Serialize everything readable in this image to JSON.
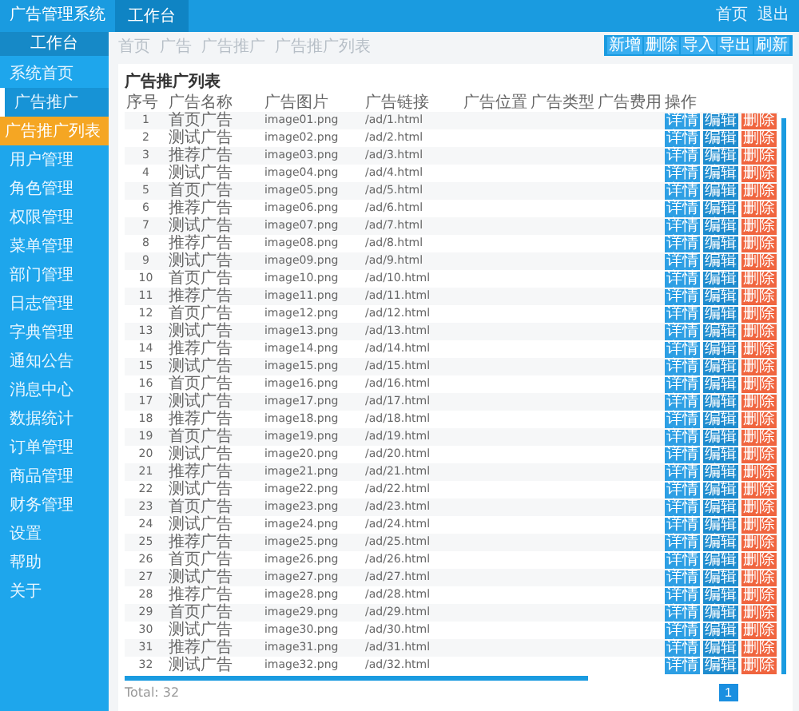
{
  "header": {
    "title": "广告管理系统",
    "tabs": [
      {
        "label": "工作台",
        "selected": true
      }
    ],
    "links": [
      "首页",
      "退出"
    ]
  },
  "sidebar": {
    "title": "工作台",
    "items": [
      {
        "label": "系统首页",
        "selected": false
      },
      {
        "label": "广告推广",
        "selected": false,
        "expanded": true,
        "children": [
          {
            "label": "广告推广列表",
            "selected": true
          }
        ]
      },
      {
        "label": "用户管理",
        "selected": false
      },
      {
        "label": "角色管理",
        "selected": false
      },
      {
        "label": "权限管理",
        "selected": false
      },
      {
        "label": "菜单管理",
        "selected": false
      },
      {
        "label": "部门管理",
        "selected": false
      },
      {
        "label": "日志管理",
        "selected": false
      },
      {
        "label": "字典管理",
        "selected": false
      },
      {
        "label": "通知公告",
        "selected": false
      },
      {
        "label": "消息中心",
        "selected": false
      },
      {
        "label": "数据统计",
        "selected": false
      },
      {
        "label": "订单管理",
        "selected": false
      },
      {
        "label": "商品管理",
        "selected": false
      },
      {
        "label": "财务管理",
        "selected": false
      },
      {
        "label": "设置",
        "selected": false
      },
      {
        "label": "帮助",
        "selected": false
      },
      {
        "label": "关于",
        "selected": false
      }
    ]
  },
  "breadcrumb": [
    "首页",
    "广告",
    "广告推广",
    "广告推广列表"
  ],
  "toolbar": [
    "新增",
    "删除",
    "导入",
    "导出",
    "刷新"
  ],
  "panel": {
    "title": "广告推广列表",
    "columns": [
      "序号",
      "广告名称",
      "广告图片",
      "广告链接",
      "广告位置",
      "广告类型",
      "广告费用",
      "操作"
    ],
    "rows": [
      {
        "no": "1",
        "name": "首页广告",
        "image": "image01.png",
        "link": "/ad/1.html",
        "actions": [
          {
            "label": "详情",
            "kind": "view"
          },
          {
            "label": "编辑",
            "kind": "edit"
          },
          {
            "label": "删除",
            "kind": "delete"
          }
        ]
      },
      {
        "no": "2",
        "name": "测试广告",
        "image": "image02.png",
        "link": "/ad/2.html",
        "actions": [
          {
            "label": "详情",
            "kind": "view"
          },
          {
            "label": "编辑",
            "kind": "edit"
          },
          {
            "label": "删除",
            "kind": "delete"
          }
        ]
      },
      {
        "no": "3",
        "name": "推荐广告",
        "image": "image03.png",
        "link": "/ad/3.html",
        "actions": [
          {
            "label": "详情",
            "kind": "view"
          },
          {
            "label": "编辑",
            "kind": "edit"
          },
          {
            "label": "删除",
            "kind": "delete"
          }
        ]
      },
      {
        "no": "4",
        "name": "测试广告",
        "image": "image04.png",
        "link": "/ad/4.html",
        "actions": [
          {
            "label": "详情",
            "kind": "view"
          },
          {
            "label": "编辑",
            "kind": "edit"
          },
          {
            "label": "删除",
            "kind": "delete"
          }
        ]
      },
      {
        "no": "5",
        "name": "首页广告",
        "image": "image05.png",
        "link": "/ad/5.html",
        "actions": [
          {
            "label": "详情",
            "kind": "view"
          },
          {
            "label": "编辑",
            "kind": "edit"
          },
          {
            "label": "删除",
            "kind": "delete"
          }
        ]
      },
      {
        "no": "6",
        "name": "推荐广告",
        "image": "image06.png",
        "link": "/ad/6.html",
        "actions": [
          {
            "label": "详情",
            "kind": "view"
          },
          {
            "label": "编辑",
            "kind": "edit"
          },
          {
            "label": "删除",
            "kind": "delete"
          }
        ]
      },
      {
        "no": "7",
        "name": "测试广告",
        "image": "image07.png",
        "link": "/ad/7.html",
        "actions": [
          {
            "label": "详情",
            "kind": "view"
          },
          {
            "label": "编辑",
            "kind": "edit"
          },
          {
            "label": "删除",
            "kind": "delete"
          }
        ]
      },
      {
        "no": "8",
        "name": "推荐广告",
        "image": "image08.png",
        "link": "/ad/8.html",
        "actions": [
          {
            "label": "详情",
            "kind": "view"
          },
          {
            "label": "编辑",
            "kind": "edit"
          },
          {
            "label": "删除",
            "kind": "delete"
          }
        ]
      },
      {
        "no": "9",
        "name": "测试广告",
        "image": "image09.png",
        "link": "/ad/9.html",
        "actions": [
          {
            "label": "详情",
            "kind": "view"
          },
          {
            "label": "编辑",
            "kind": "edit"
          },
          {
            "label": "删除",
            "kind": "delete"
          }
        ]
      },
      {
        "no": "10",
        "name": "首页广告",
        "image": "image10.png",
        "link": "/ad/10.html",
        "actions": [
          {
            "label": "详情",
            "kind": "view"
          },
          {
            "label": "编辑",
            "kind": "edit"
          },
          {
            "label": "删除",
            "kind": "delete"
          }
        ]
      },
      {
        "no": "11",
        "name": "推荐广告",
        "image": "image11.png",
        "link": "/ad/11.html",
        "actions": [
          {
            "label": "详情",
            "kind": "view"
          },
          {
            "label": "编辑",
            "kind": "edit"
          },
          {
            "label": "删除",
            "kind": "delete"
          }
        ]
      },
      {
        "no": "12",
        "name": "首页广告",
        "image": "image12.png",
        "link": "/ad/12.html",
        "actions": [
          {
            "label": "详情",
            "kind": "view"
          },
          {
            "label": "编辑",
            "kind": "edit"
          },
          {
            "label": "删除",
            "kind": "delete"
          }
        ]
      },
      {
        "no": "13",
        "name": "测试广告",
        "image": "image13.png",
        "link": "/ad/13.html",
        "actions": [
          {
            "label": "详情",
            "kind": "view"
          },
          {
            "label": "编辑",
            "kind": "edit"
          },
          {
            "label": "删除",
            "kind": "delete"
          }
        ]
      },
      {
        "no": "14",
        "name": "推荐广告",
        "image": "image14.png",
        "link": "/ad/14.html",
        "actions": [
          {
            "label": "详情",
            "kind": "view"
          },
          {
            "label": "编辑",
            "kind": "edit"
          },
          {
            "label": "删除",
            "kind": "delete"
          }
        ]
      },
      {
        "no": "15",
        "name": "测试广告",
        "image": "image15.png",
        "link": "/ad/15.html",
        "actions": [
          {
            "label": "详情",
            "kind": "view"
          },
          {
            "label": "编辑",
            "kind": "edit"
          },
          {
            "label": "删除",
            "kind": "delete"
          }
        ]
      },
      {
        "no": "16",
        "name": "首页广告",
        "image": "image16.png",
        "link": "/ad/16.html",
        "actions": [
          {
            "label": "详情",
            "kind": "view"
          },
          {
            "label": "编辑",
            "kind": "edit"
          },
          {
            "label": "删除",
            "kind": "delete"
          }
        ]
      },
      {
        "no": "17",
        "name": "测试广告",
        "image": "image17.png",
        "link": "/ad/17.html",
        "actions": [
          {
            "label": "详情",
            "kind": "view"
          },
          {
            "label": "编辑",
            "kind": "edit"
          },
          {
            "label": "删除",
            "kind": "delete"
          }
        ]
      },
      {
        "no": "18",
        "name": "推荐广告",
        "image": "image18.png",
        "link": "/ad/18.html",
        "actions": [
          {
            "label": "详情",
            "kind": "view"
          },
          {
            "label": "编辑",
            "kind": "edit"
          },
          {
            "label": "删除",
            "kind": "delete"
          }
        ]
      },
      {
        "no": "19",
        "name": "首页广告",
        "image": "image19.png",
        "link": "/ad/19.html",
        "actions": [
          {
            "label": "详情",
            "kind": "view"
          },
          {
            "label": "编辑",
            "kind": "edit"
          },
          {
            "label": "删除",
            "kind": "delete"
          }
        ]
      },
      {
        "no": "20",
        "name": "测试广告",
        "image": "image20.png",
        "link": "/ad/20.html",
        "actions": [
          {
            "label": "详情",
            "kind": "view"
          },
          {
            "label": "编辑",
            "kind": "edit"
          },
          {
            "label": "删除",
            "kind": "delete"
          }
        ]
      },
      {
        "no": "21",
        "name": "推荐广告",
        "image": "image21.png",
        "link": "/ad/21.html",
        "actions": [
          {
            "label": "详情",
            "kind": "view"
          },
          {
            "label": "编辑",
            "kind": "edit"
          },
          {
            "label": "删除",
            "kind": "delete"
          }
        ]
      },
      {
        "no": "22",
        "name": "测试广告",
        "image": "image22.png",
        "link": "/ad/22.html",
        "actions": [
          {
            "label": "详情",
            "kind": "view"
          },
          {
            "label": "编辑",
            "kind": "edit"
          },
          {
            "label": "删除",
            "kind": "delete"
          }
        ]
      },
      {
        "no": "23",
        "name": "首页广告",
        "image": "image23.png",
        "link": "/ad/23.html",
        "actions": [
          {
            "label": "详情",
            "kind": "view"
          },
          {
            "label": "编辑",
            "kind": "edit"
          },
          {
            "label": "删除",
            "kind": "delete"
          }
        ]
      },
      {
        "no": "24",
        "name": "测试广告",
        "image": "image24.png",
        "link": "/ad/24.html",
        "actions": [
          {
            "label": "详情",
            "kind": "view"
          },
          {
            "label": "编辑",
            "kind": "edit"
          },
          {
            "label": "删除",
            "kind": "delete"
          }
        ]
      },
      {
        "no": "25",
        "name": "推荐广告",
        "image": "image25.png",
        "link": "/ad/25.html",
        "actions": [
          {
            "label": "详情",
            "kind": "view"
          },
          {
            "label": "编辑",
            "kind": "edit"
          },
          {
            "label": "删除",
            "kind": "delete"
          }
        ]
      },
      {
        "no": "26",
        "name": "首页广告",
        "image": "image26.png",
        "link": "/ad/26.html",
        "actions": [
          {
            "label": "详情",
            "kind": "view"
          },
          {
            "label": "编辑",
            "kind": "edit"
          },
          {
            "label": "删除",
            "kind": "delete"
          }
        ]
      },
      {
        "no": "27",
        "name": "测试广告",
        "image": "image27.png",
        "link": "/ad/27.html",
        "actions": [
          {
            "label": "详情",
            "kind": "view"
          },
          {
            "label": "编辑",
            "kind": "edit"
          },
          {
            "label": "删除",
            "kind": "delete"
          }
        ]
      },
      {
        "no": "28",
        "name": "推荐广告",
        "image": "image28.png",
        "link": "/ad/28.html",
        "actions": [
          {
            "label": "详情",
            "kind": "view"
          },
          {
            "label": "编辑",
            "kind": "edit"
          },
          {
            "label": "删除",
            "kind": "delete"
          }
        ]
      },
      {
        "no": "29",
        "name": "首页广告",
        "image": "image29.png",
        "link": "/ad/29.html",
        "actions": [
          {
            "label": "详情",
            "kind": "view"
          },
          {
            "label": "编辑",
            "kind": "edit"
          },
          {
            "label": "删除",
            "kind": "delete"
          }
        ]
      },
      {
        "no": "30",
        "name": "测试广告",
        "image": "image30.png",
        "link": "/ad/30.html",
        "actions": [
          {
            "label": "详情",
            "kind": "view"
          },
          {
            "label": "编辑",
            "kind": "edit"
          },
          {
            "label": "删除",
            "kind": "delete"
          }
        ]
      },
      {
        "no": "31",
        "name": "推荐广告",
        "image": "image31.png",
        "link": "/ad/31.html",
        "actions": [
          {
            "label": "详情",
            "kind": "view"
          },
          {
            "label": "编辑",
            "kind": "edit"
          },
          {
            "label": "删除",
            "kind": "delete"
          }
        ]
      },
      {
        "no": "32",
        "name": "测试广告",
        "image": "image32.png",
        "link": "/ad/32.html",
        "actions": [
          {
            "label": "详情",
            "kind": "view"
          },
          {
            "label": "编辑",
            "kind": "edit"
          },
          {
            "label": "删除",
            "kind": "delete"
          }
        ]
      }
    ]
  },
  "footer": {
    "total": "Total: 32",
    "pages": [
      {
        "label": "1",
        "selected": true
      }
    ]
  }
}
